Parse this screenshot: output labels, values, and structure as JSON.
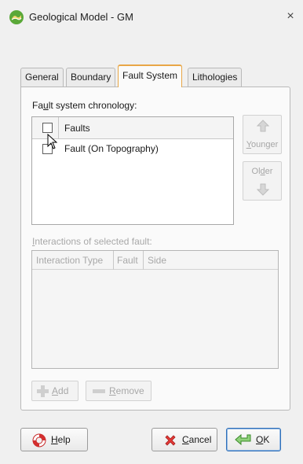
{
  "window": {
    "title": "Geological Model - GM",
    "close_glyph": "×",
    "app_icon": "geological-model-app-icon"
  },
  "tabs": [
    {
      "label": "General",
      "active": false
    },
    {
      "label": "Boundary",
      "active": false
    },
    {
      "label": "Fault System",
      "active": true
    },
    {
      "label": "Lithologies",
      "active": false
    }
  ],
  "chronology": {
    "label_pre": "Fa",
    "label_accel": "u",
    "label_post": "lt system chronology:",
    "column_header": "Faults",
    "rows": [
      {
        "name": "Fault (On Topography)",
        "checked": false
      }
    ]
  },
  "side_buttons": {
    "younger": {
      "accel": "Y",
      "rest": "ounger",
      "icon": "arrow-up-icon",
      "enabled": false
    },
    "older": {
      "pre": "Ol",
      "accel": "d",
      "post": "er",
      "icon": "arrow-down-icon",
      "enabled": false
    }
  },
  "interactions": {
    "label_accel": "I",
    "label_rest": "nteractions of selected fault:",
    "columns": [
      "Interaction Type",
      "Fault",
      "Side"
    ],
    "rows": []
  },
  "action_buttons": {
    "add": {
      "accel": "A",
      "rest": "dd",
      "icon": "plus-icon",
      "enabled": false
    },
    "remove": {
      "accel": "R",
      "rest": "emove",
      "icon": "minus-icon",
      "enabled": false
    }
  },
  "dialog_buttons": {
    "help": {
      "accel": "H",
      "rest": "elp",
      "icon": "lifebuoy-icon"
    },
    "cancel": {
      "accel": "C",
      "rest": "ancel",
      "icon": "red-x-icon"
    },
    "ok": {
      "accel": "O",
      "rest": "K",
      "icon": "return-arrow-icon"
    }
  },
  "colors": {
    "active_tab_border": "#e8a646",
    "disabled_text": "#a6a6a6",
    "default_button_border": "#2f6fb8"
  }
}
